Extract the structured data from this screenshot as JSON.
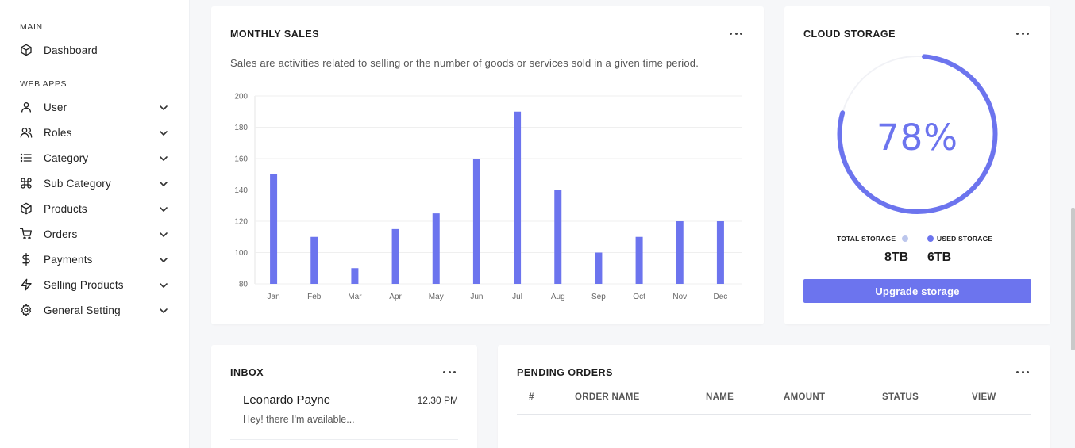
{
  "sidebar": {
    "sections": {
      "main": "MAIN",
      "web_apps": "WEB APPS"
    },
    "items": [
      {
        "label": "Dashboard",
        "icon": "box-icon"
      },
      {
        "label": "User",
        "icon": "user-icon"
      },
      {
        "label": "Roles",
        "icon": "users-icon"
      },
      {
        "label": "Category",
        "icon": "list-icon"
      },
      {
        "label": "Sub Category",
        "icon": "command-icon"
      },
      {
        "label": "Products",
        "icon": "box-icon"
      },
      {
        "label": "Orders",
        "icon": "cart-icon"
      },
      {
        "label": "Payments",
        "icon": "dollar-icon"
      },
      {
        "label": "Selling Products",
        "icon": "lightning-icon"
      },
      {
        "label": "General Setting",
        "icon": "gear-icon"
      }
    ]
  },
  "monthly_sales": {
    "title": "MONTHLY SALES",
    "subtitle": "Sales are activities related to selling or the number of goods or services sold in a given time period."
  },
  "chart_data": {
    "type": "bar",
    "categories": [
      "Jan",
      "Feb",
      "Mar",
      "Apr",
      "May",
      "Jun",
      "Jul",
      "Aug",
      "Sep",
      "Oct",
      "Nov",
      "Dec"
    ],
    "values": [
      150,
      110,
      90,
      115,
      125,
      160,
      190,
      140,
      100,
      110,
      120,
      120
    ],
    "yticks": [
      80,
      100,
      120,
      140,
      160,
      180,
      200
    ],
    "ylim": [
      80,
      200
    ],
    "grid": true,
    "color": "#6c74ee"
  },
  "cloud_storage": {
    "title": "CLOUD STORAGE",
    "percent_label": "78%",
    "percent": 78,
    "total_label": "TOTAL STORAGE",
    "used_label": "USED STORAGE",
    "total_value": "8TB",
    "used_value": "6TB",
    "button_label": "Upgrade storage",
    "colors": {
      "accent": "#6c74ee",
      "track": "#f1f2f6",
      "total_dot": "#bcc6ec"
    }
  },
  "inbox": {
    "title": "INBOX",
    "messages": [
      {
        "name": "Leonardo Payne",
        "time": "12.30 PM",
        "text": "Hey! there I'm available..."
      }
    ]
  },
  "pending_orders": {
    "title": "PENDING ORDERS",
    "columns": [
      "#",
      "ORDER NAME",
      "NAME",
      "AMOUNT",
      "STATUS",
      "VIEW"
    ]
  }
}
